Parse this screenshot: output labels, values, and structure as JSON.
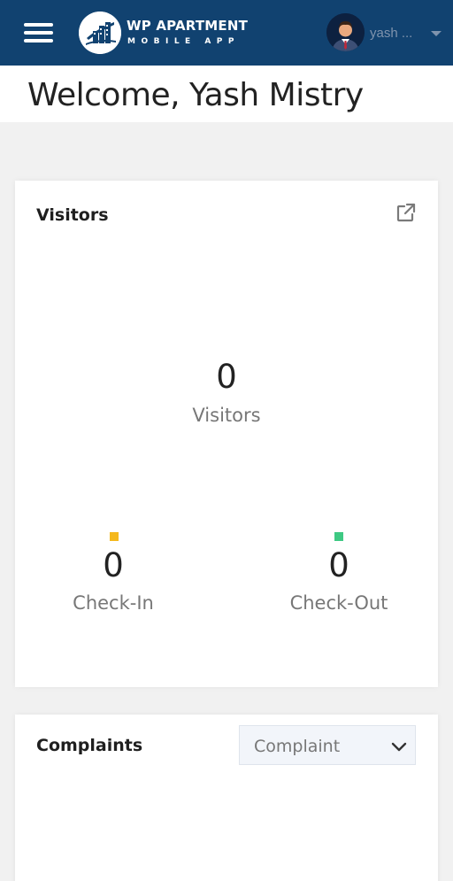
{
  "header": {
    "logo_title": "WP APARTMENT",
    "logo_subtitle": "MOBILE APP",
    "user_name": "yash ...",
    "brand_color": "#114270"
  },
  "welcome": "Welcome, Yash Mistry",
  "visitors_card": {
    "title": "Visitors",
    "total_value": "0",
    "total_label": "Visitors",
    "check_in_value": "0",
    "check_in_label": "Check-In",
    "check_in_color": "#f5b81c",
    "check_out_value": "0",
    "check_out_label": "Check-Out",
    "check_out_color": "#3ec983",
    "icon": "external-link-icon"
  },
  "complaints_card": {
    "title": "Complaints",
    "select_value": "Complaint",
    "icon": "chevron-down-icon"
  }
}
